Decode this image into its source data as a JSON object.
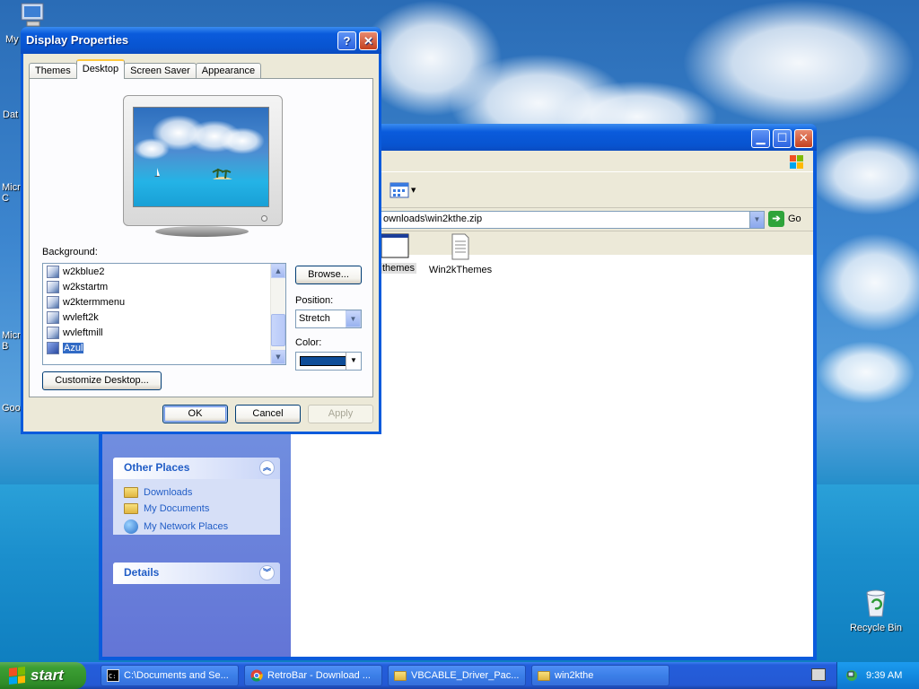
{
  "desktop": {
    "icon_labels": [
      "My",
      "Dat",
      "Micro C",
      "Micro B",
      "Goo"
    ],
    "recycle_bin": "Recycle Bin"
  },
  "explorer": {
    "address": "ownloads\\win2kthe.zip",
    "go_label": "Go",
    "files": [
      {
        "name": "themes",
        "icon": "folder-window-icon"
      },
      {
        "name": "Win2kThemes",
        "icon": "document-icon"
      }
    ],
    "other_places": {
      "title": "Other Places",
      "items": [
        "Downloads",
        "My Documents",
        "My Network Places"
      ]
    },
    "details_title": "Details"
  },
  "dialog": {
    "title": "Display Properties",
    "tabs": [
      "Themes",
      "Desktop",
      "Screen Saver",
      "Appearance"
    ],
    "active_tab": "Desktop",
    "background_label": "Background:",
    "background_items": [
      "w2kblue2",
      "w2kstartm",
      "w2ktermmenu",
      "wvleft2k",
      "wvleftmill",
      "Azul"
    ],
    "selected_background": "Azul",
    "browse_button": "Browse...",
    "position_label": "Position:",
    "position_value": "Stretch",
    "color_label": "Color:",
    "color_value": "#0e4d98",
    "customize_button": "Customize Desktop...",
    "ok": "OK",
    "cancel": "Cancel",
    "apply": "Apply"
  },
  "taskbar": {
    "start": "start",
    "tasks": [
      "C:\\Documents and Se...",
      "RetroBar - Download ...",
      "VBCABLE_Driver_Pac...",
      "win2kthe"
    ],
    "clock": "9:39 AM"
  }
}
